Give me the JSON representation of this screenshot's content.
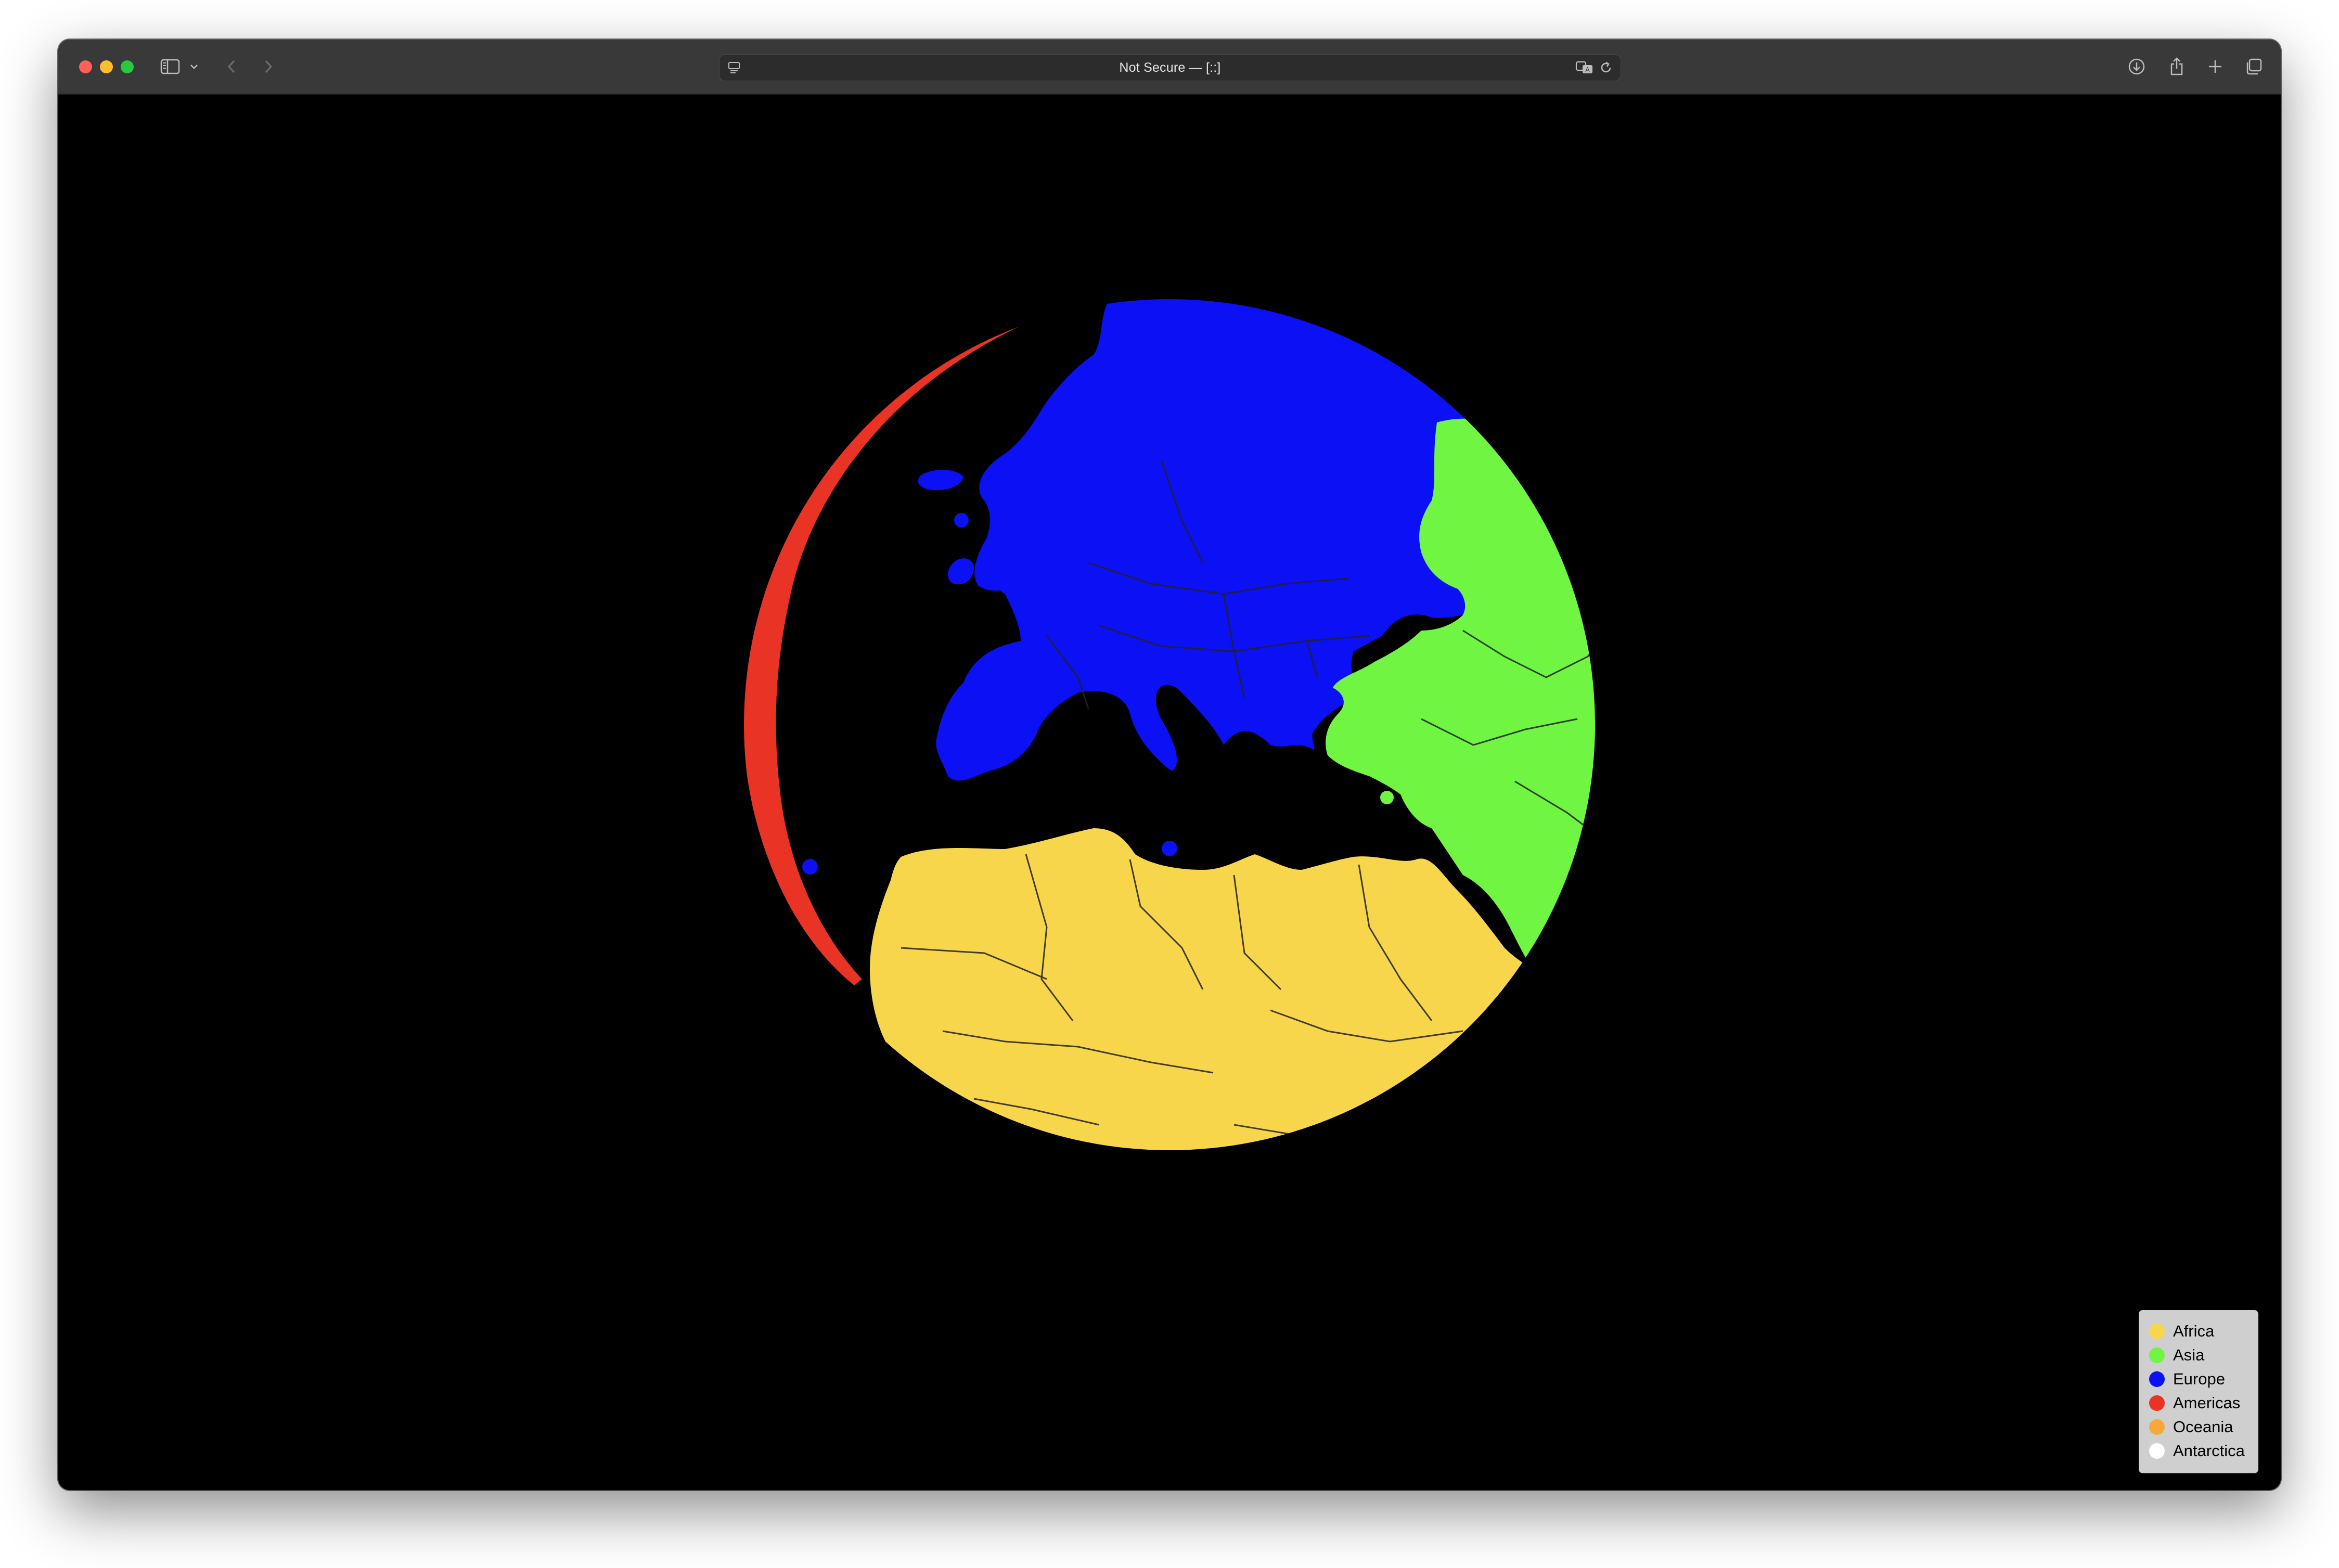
{
  "browser": {
    "url_display": "Not Secure — [::]"
  },
  "toolbar_icons": {
    "close": "close-traffic-light",
    "minimize": "minimize-traffic-light",
    "zoom": "zoom-traffic-light",
    "sidebar": "sidebar-icon",
    "sidebar_menu": "chevron-down-icon",
    "back": "back-arrow-icon",
    "forward": "forward-arrow-icon",
    "page_menu": "page-menu-icon",
    "translate": "translate-icon",
    "reload": "reload-icon",
    "downloads": "download-icon",
    "share": "share-icon",
    "new_tab": "plus-icon",
    "tab_overview": "tabs-icon"
  },
  "colors": {
    "africa": "#f8d64b",
    "asia": "#6ff542",
    "europe": "#0b10f5",
    "americas": "#e93324",
    "oceania": "#f6a93a",
    "antarctica": "#ffffff",
    "background": "#000000",
    "borders": "#222222"
  },
  "legend": {
    "items": [
      {
        "label": "Africa",
        "color": "#f8d64b"
      },
      {
        "label": "Asia",
        "color": "#6ff542"
      },
      {
        "label": "Europe",
        "color": "#0b10f5"
      },
      {
        "label": "Americas",
        "color": "#e93324"
      },
      {
        "label": "Oceania",
        "color": "#f6a93a"
      },
      {
        "label": "Antarctica",
        "color": "#ffffff"
      }
    ]
  }
}
